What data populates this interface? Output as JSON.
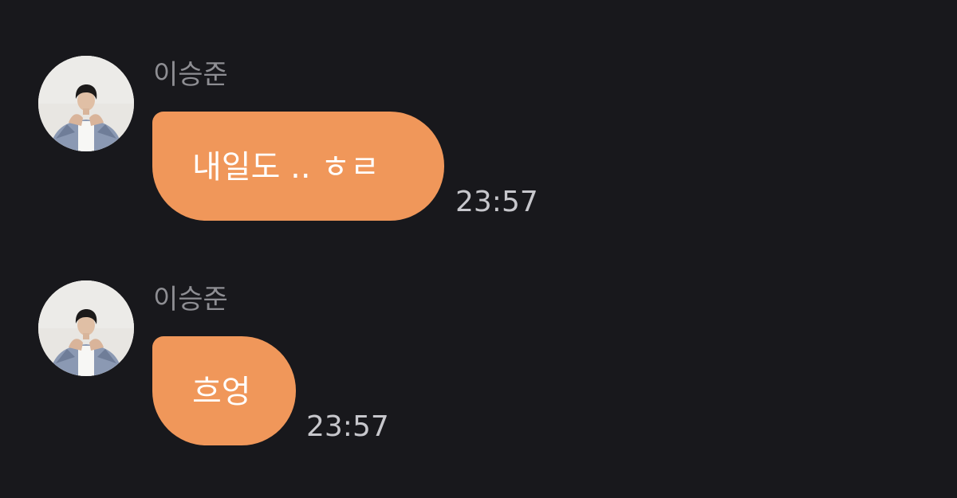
{
  "messages": [
    {
      "sender": "이승준",
      "text": "내일도 .. ㅎㄹ",
      "time": "23:57"
    },
    {
      "sender": "이승준",
      "text": "흐엉",
      "time": "23:57"
    }
  ],
  "colors": {
    "background": "#18181c",
    "bubble": "#f0975a",
    "name": "#8e8e93",
    "time": "#c7c7cc"
  }
}
